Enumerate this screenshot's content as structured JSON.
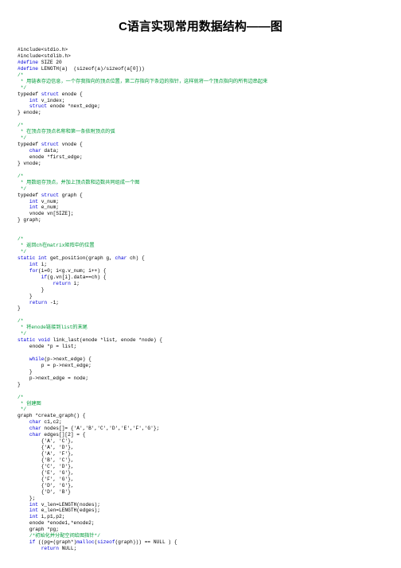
{
  "title": "C语言实现常用数据结构——图",
  "code_lines": [
    {
      "t": "#include<stdio.h>"
    },
    {
      "t": "#include<stdlib.h>"
    },
    {
      "t": "",
      "segs": [
        {
          "c": "kw",
          "t": "#define"
        },
        {
          "t": " SIZE 20"
        }
      ]
    },
    {
      "t": "",
      "segs": [
        {
          "c": "kw",
          "t": "#define"
        },
        {
          "t": " LENGTH(a)  (sizeof(a)/sizeof(a[0]))"
        }
      ]
    },
    {
      "t": "",
      "segs": [
        {
          "c": "cm",
          "t": "/*"
        }
      ]
    },
    {
      "t": "",
      "segs": [
        {
          "c": "cm",
          "t": " * 用链表存边信息，一个存我指向的顶点位置，第二存指向下条边的指针，这样就将一个顶点指向的所有边串起来"
        }
      ]
    },
    {
      "t": "",
      "segs": [
        {
          "c": "cm",
          "t": " */"
        }
      ]
    },
    {
      "t": "",
      "segs": [
        {
          "t": "typedef "
        },
        {
          "c": "kw",
          "t": "struct"
        },
        {
          "t": " enode {"
        }
      ]
    },
    {
      "t": "",
      "segs": [
        {
          "t": "    "
        },
        {
          "c": "kw",
          "t": "int"
        },
        {
          "t": " v_index;"
        }
      ]
    },
    {
      "t": "",
      "segs": [
        {
          "t": "    "
        },
        {
          "c": "kw",
          "t": "struct"
        },
        {
          "t": " enode *next_edge;"
        }
      ]
    },
    {
      "t": "} enode;"
    },
    {
      "t": ""
    },
    {
      "t": "",
      "segs": [
        {
          "c": "cm",
          "t": "/*"
        }
      ]
    },
    {
      "t": "",
      "segs": [
        {
          "c": "cm",
          "t": " * 在顶点存顶点名称和第一条依附顶点的弧"
        }
      ]
    },
    {
      "t": "",
      "segs": [
        {
          "c": "cm",
          "t": " */"
        }
      ]
    },
    {
      "t": "",
      "segs": [
        {
          "t": "typedef "
        },
        {
          "c": "kw",
          "t": "struct"
        },
        {
          "t": " vnode {"
        }
      ]
    },
    {
      "t": "",
      "segs": [
        {
          "t": "    "
        },
        {
          "c": "kw",
          "t": "char"
        },
        {
          "t": " data;"
        }
      ]
    },
    {
      "t": "    enode *first_edge;"
    },
    {
      "t": "} vnode;"
    },
    {
      "t": ""
    },
    {
      "t": "",
      "segs": [
        {
          "c": "cm",
          "t": "/*"
        }
      ]
    },
    {
      "t": "",
      "segs": [
        {
          "c": "cm",
          "t": " * 用数组存顶点，并加上顶点数和边数共同组成一个图"
        }
      ]
    },
    {
      "t": "",
      "segs": [
        {
          "c": "cm",
          "t": " */"
        }
      ]
    },
    {
      "t": "",
      "segs": [
        {
          "t": "typedef "
        },
        {
          "c": "kw",
          "t": "struct"
        },
        {
          "t": " graph {"
        }
      ]
    },
    {
      "t": "",
      "segs": [
        {
          "t": "    "
        },
        {
          "c": "kw",
          "t": "int"
        },
        {
          "t": " v_num;"
        }
      ]
    },
    {
      "t": "",
      "segs": [
        {
          "t": "    "
        },
        {
          "c": "kw",
          "t": "int"
        },
        {
          "t": " e_num;"
        }
      ]
    },
    {
      "t": "    vnode vn[SIZE];"
    },
    {
      "t": "} graph;"
    },
    {
      "t": ""
    },
    {
      "t": ""
    },
    {
      "t": "",
      "segs": [
        {
          "c": "cm",
          "t": "/*"
        }
      ]
    },
    {
      "t": "",
      "segs": [
        {
          "c": "cm",
          "t": " * 返回ch在matrix矩阵中的位置"
        }
      ]
    },
    {
      "t": "",
      "segs": [
        {
          "c": "cm",
          "t": " */"
        }
      ]
    },
    {
      "t": "",
      "segs": [
        {
          "c": "kw",
          "t": "static int"
        },
        {
          "t": " get_position(graph g, "
        },
        {
          "c": "kw",
          "t": "char"
        },
        {
          "t": " ch) {"
        }
      ]
    },
    {
      "t": "",
      "segs": [
        {
          "t": "    "
        },
        {
          "c": "kw",
          "t": "int"
        },
        {
          "t": " i;"
        }
      ]
    },
    {
      "t": "",
      "segs": [
        {
          "t": "    "
        },
        {
          "c": "kw",
          "t": "for"
        },
        {
          "t": "(i=0; i<g.v_num; i++) {"
        }
      ]
    },
    {
      "t": "",
      "segs": [
        {
          "t": "        "
        },
        {
          "c": "kw",
          "t": "if"
        },
        {
          "t": "(g.vn[i].data==ch) {"
        }
      ]
    },
    {
      "t": "",
      "segs": [
        {
          "t": "            "
        },
        {
          "c": "kw",
          "t": "return"
        },
        {
          "t": " i;"
        }
      ]
    },
    {
      "t": "        }"
    },
    {
      "t": "    }"
    },
    {
      "t": "",
      "segs": [
        {
          "t": "    "
        },
        {
          "c": "kw",
          "t": "return"
        },
        {
          "t": " -1;"
        }
      ]
    },
    {
      "t": "}"
    },
    {
      "t": ""
    },
    {
      "t": "",
      "segs": [
        {
          "c": "cm",
          "t": "/*"
        }
      ]
    },
    {
      "t": "",
      "segs": [
        {
          "c": "cm",
          "t": " * 将enode链接到list的末尾"
        }
      ]
    },
    {
      "t": "",
      "segs": [
        {
          "c": "cm",
          "t": " */"
        }
      ]
    },
    {
      "t": "",
      "segs": [
        {
          "c": "kw",
          "t": "static void"
        },
        {
          "t": " link_last(enode *list, enode *node) {"
        }
      ]
    },
    {
      "t": "    enode *p = list;"
    },
    {
      "t": ""
    },
    {
      "t": "",
      "segs": [
        {
          "t": "    "
        },
        {
          "c": "kw",
          "t": "while"
        },
        {
          "t": "(p->next_edge) {"
        }
      ]
    },
    {
      "t": "        p = p->next_edge;"
    },
    {
      "t": "    }"
    },
    {
      "t": "    p->next_edge = node;"
    },
    {
      "t": "}"
    },
    {
      "t": ""
    },
    {
      "t": "",
      "segs": [
        {
          "c": "cm",
          "t": "/*"
        }
      ]
    },
    {
      "t": "",
      "segs": [
        {
          "c": "cm",
          "t": " * 创建图"
        }
      ]
    },
    {
      "t": "",
      "segs": [
        {
          "c": "cm",
          "t": " */"
        }
      ]
    },
    {
      "t": "graph *create_graph() {"
    },
    {
      "t": "",
      "segs": [
        {
          "t": "    "
        },
        {
          "c": "kw",
          "t": "char"
        },
        {
          "t": " c1,c2;"
        }
      ]
    },
    {
      "t": "",
      "segs": [
        {
          "t": "    "
        },
        {
          "c": "kw",
          "t": "char"
        },
        {
          "t": " nodes[]= {'A','B','C','D','E','F','G'};"
        }
      ]
    },
    {
      "t": "",
      "segs": [
        {
          "t": "    "
        },
        {
          "c": "kw",
          "t": "char"
        },
        {
          "t": " edges[][2] = {"
        }
      ]
    },
    {
      "t": "        {'A', 'C'},"
    },
    {
      "t": "        {'A', 'D'},"
    },
    {
      "t": "        {'A', 'F'},"
    },
    {
      "t": "        {'B', 'C'},"
    },
    {
      "t": "        {'C', 'D'},"
    },
    {
      "t": "        {'E', 'G'},"
    },
    {
      "t": "        {'F', 'G'},"
    },
    {
      "t": "        {'D', 'G'},"
    },
    {
      "t": "        {'D', 'B'}"
    },
    {
      "t": "    };"
    },
    {
      "t": "",
      "segs": [
        {
          "t": "    "
        },
        {
          "c": "kw",
          "t": "int"
        },
        {
          "t": " v_len=LENGTH(nodes);"
        }
      ]
    },
    {
      "t": "",
      "segs": [
        {
          "t": "    "
        },
        {
          "c": "kw",
          "t": "int"
        },
        {
          "t": " e_len=LENGTH(edges);"
        }
      ]
    },
    {
      "t": "",
      "segs": [
        {
          "t": "    "
        },
        {
          "c": "kw",
          "t": "int"
        },
        {
          "t": " i,p1,p2;"
        }
      ]
    },
    {
      "t": "    enode *enode1,*enode2;"
    },
    {
      "t": "    graph *pg;"
    },
    {
      "t": "",
      "segs": [
        {
          "t": "    "
        },
        {
          "c": "cm",
          "t": "/*初始化并分配空间给图指针*/"
        }
      ]
    },
    {
      "t": "",
      "segs": [
        {
          "t": "    "
        },
        {
          "c": "kw",
          "t": "if"
        },
        {
          "t": " ((pg=(graph*)"
        },
        {
          "c": "kw",
          "t": "malloc"
        },
        {
          "t": "("
        },
        {
          "c": "kw",
          "t": "sizeof"
        },
        {
          "t": "(graph))) == NULL ) {"
        }
      ]
    },
    {
      "t": "",
      "segs": [
        {
          "t": "        "
        },
        {
          "c": "kw",
          "t": "return"
        },
        {
          "t": " NULL;"
        }
      ]
    }
  ]
}
